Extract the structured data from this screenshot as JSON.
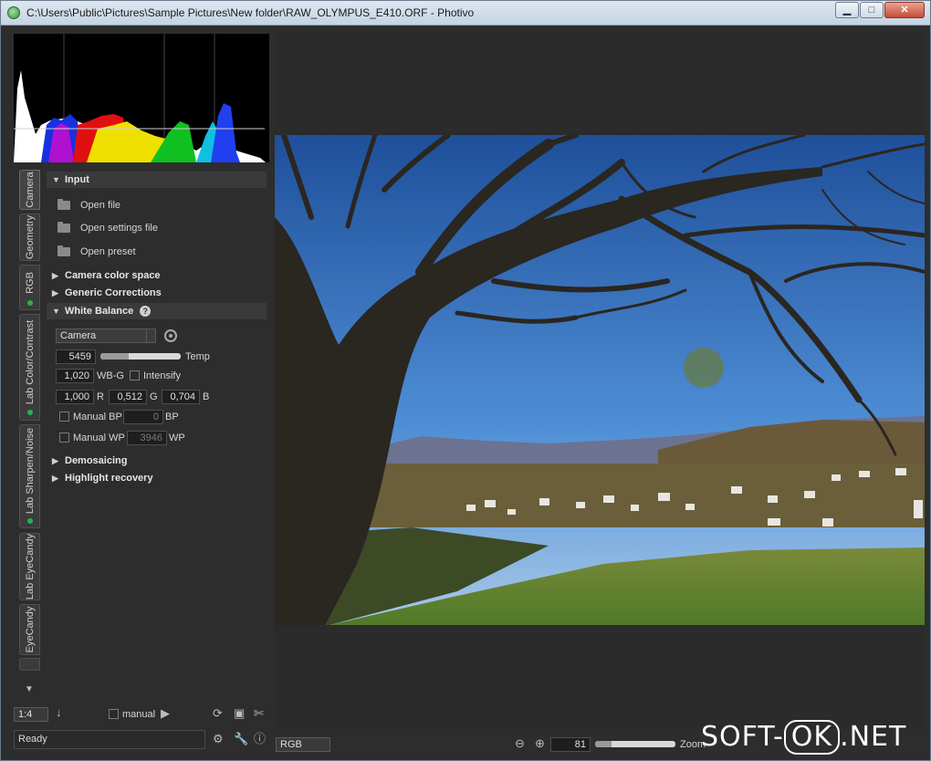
{
  "window": {
    "title": "C:\\Users\\Public\\Pictures\\Sample Pictures\\New folder\\RAW_OLYMPUS_E410.ORF - Photivo",
    "controls": {
      "minimize": "▁",
      "maximize": "□",
      "close": "✕"
    }
  },
  "tabs": [
    {
      "label": "Camera",
      "active": true,
      "indicator": false
    },
    {
      "label": "Geometry",
      "active": false,
      "indicator": false
    },
    {
      "label": "RGB",
      "active": false,
      "indicator": true
    },
    {
      "label": "Lab Color/Contrast",
      "active": false,
      "indicator": true
    },
    {
      "label": "Lab Sharpen/Noise",
      "active": false,
      "indicator": true
    },
    {
      "label": "Lab EyeCandy",
      "active": false,
      "indicator": false
    },
    {
      "label": "EyeCandy",
      "active": false,
      "indicator": false
    }
  ],
  "input": {
    "header": "Input",
    "open_file": "Open file",
    "open_settings": "Open settings file",
    "open_preset": "Open preset"
  },
  "sections": {
    "camera_color_space": "Camera color space",
    "generic_corrections": "Generic Corrections",
    "white_balance": "White Balance",
    "demosaicing": "Demosaicing",
    "highlight_recovery": "Highlight recovery"
  },
  "white_balance": {
    "mode": "Camera",
    "temp_value": "5459",
    "temp_label": "Temp",
    "temp_slider_fraction": 0.35,
    "wbg_value": "1,020",
    "wbg_label": "WB-G",
    "intensify_label": "Intensify",
    "r_value": "1,000",
    "r_label": "R",
    "g_value": "0,512",
    "g_label": "G",
    "b_value": "0,704",
    "b_label": "B",
    "manual_bp_label": "Manual BP",
    "bp_value": "0",
    "bp_label": "BP",
    "manual_wp_label": "Manual WP",
    "wp_value": "3946",
    "wp_label": "WP"
  },
  "bottom_left": {
    "zoom_ratio": "1:4",
    "manual_label": "manual",
    "status": "Ready"
  },
  "bottom_viewer": {
    "channel": "RGB",
    "zoom_value": "81",
    "zoom_label": "Zoom",
    "zoom_slider_fraction": 0.2
  },
  "watermark": {
    "left": "SOFT-",
    "ok": "OK",
    "right": ".NET"
  },
  "icons": {
    "histogram": "histogram",
    "folder": "folder-icon",
    "picker": "color-picker-icon",
    "help": "help-icon"
  }
}
